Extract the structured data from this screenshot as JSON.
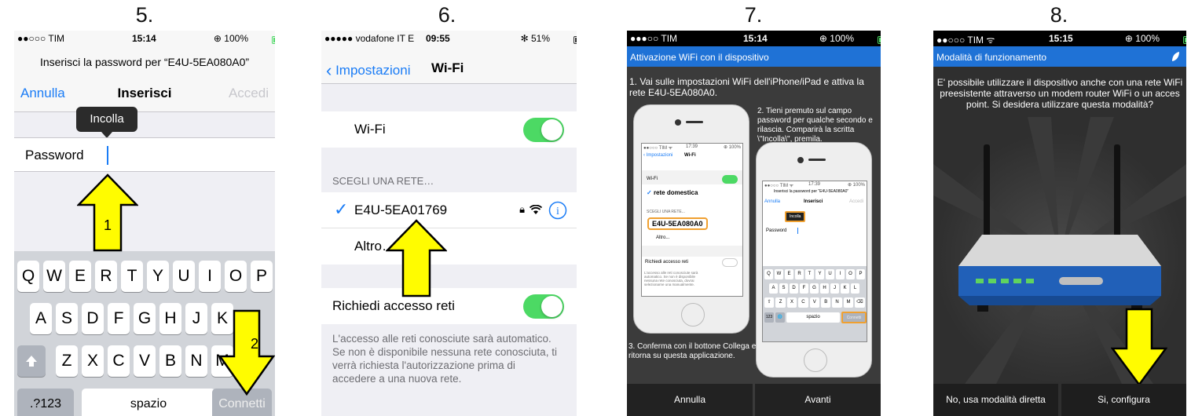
{
  "steps": [
    "5.",
    "6.",
    "7.",
    "8."
  ],
  "colors": {
    "ios_blue": "#1a7cf6",
    "toggle_green": "#4cd964",
    "app_blue": "#1f72d6",
    "arrow_yellow": "#fffc00",
    "highlight_orange": "#f0a030"
  },
  "p5": {
    "carrier": "●●○○○ TIM",
    "time": "15:14",
    "battery": "100%",
    "prompt": "Inserisci la password per “E4U-5EA080A0”",
    "cancel": "Annulla",
    "title": "Inserisci",
    "access": "Accedi",
    "paste": "Incolla",
    "password_label": "Password",
    "arrow1": "1",
    "arrow2": "2",
    "row1": [
      "Q",
      "W",
      "E",
      "R",
      "T",
      "Y",
      "U",
      "I",
      "O",
      "P"
    ],
    "row2": [
      "A",
      "S",
      "D",
      "F",
      "G",
      "H",
      "J",
      "K"
    ],
    "row3": [
      "Z",
      "X",
      "C",
      "V",
      "B",
      "N",
      "M"
    ],
    "numkey": ".?123",
    "space": "spazio",
    "connect": "Connetti"
  },
  "p6": {
    "carrier": "●●●●● vodafone IT  E",
    "time": "09:55",
    "battery": "51%",
    "back": "Impostazioni",
    "title": "Wi-Fi",
    "wifi_label": "Wi-Fi",
    "section": "SCEGLI UNA RETE…",
    "network": "E4U-5EA01769",
    "other": "Altro…",
    "ask_label": "Richiedi accesso reti",
    "footer": "L'accesso alle reti conosciute sarà automatico. Se non è disponibile nessuna rete conosciuta, ti verrà richiesta l'autorizzazione prima di accedere a una nuova rete."
  },
  "p7": {
    "carrier": "●●●○○ TIM",
    "time": "15:14",
    "battery": "100%",
    "bar_title": "Attivazione WiFi con il dispositivo",
    "text1": "1. Vai sulle impostazioni WiFi dell'iPhone/iPad e attiva la rete E4U-5EA080A0.",
    "text2": "2. Tieni premuto sul campo password per qualche secondo e rilascia. Comparirà la scritta \\\"Incolla\\\", premila.",
    "text3": "3. Conferma con il bottone Collega e ritorna su questa applicazione.",
    "btn_cancel": "Annulla",
    "btn_next": "Avanti",
    "mini_left": {
      "status_left": "●●○○○ TIM ᯤ",
      "status_time": "17:39",
      "status_right": "⊕ 100%",
      "back": "Impostazioni",
      "title": "Wi-Fi",
      "wifi": "Wi-Fi",
      "home_net": "rete domestica",
      "section": "SCEGLI UNA RETE...",
      "network": "E4U-5EA080A0",
      "other": "Altro...",
      "ask": "Richiedi accesso reti",
      "footer": "L'accesso alle reti conosciute sarà automatico. Se non è disponibile nessuna rete conosciuta, dovrai selezionarne una manualmente."
    },
    "mini_right": {
      "status_left": "●●○○○ TIM ᯤ",
      "status_time": "17:39",
      "status_right": "⊕ 100%",
      "prompt": "Inserisci la password per “E4U-5EA080A0”",
      "cancel": "Annulla",
      "title": "Inserisci",
      "access": "Accedi",
      "paste": "Incolla",
      "password": "Password",
      "row1": [
        "Q",
        "W",
        "E",
        "R",
        "T",
        "Y",
        "U",
        "I",
        "O",
        "P"
      ],
      "row2": [
        "A",
        "S",
        "D",
        "F",
        "G",
        "H",
        "J",
        "K",
        "L"
      ],
      "row3": [
        "⇧",
        "Z",
        "X",
        "C",
        "V",
        "B",
        "N",
        "M",
        "⌫"
      ],
      "numkey": "123",
      "globe": "🌐",
      "space": "spazio",
      "connect": "Connetti"
    }
  },
  "p8": {
    "carrier": "●●○○○ TIM ᯤ",
    "time": "15:15",
    "battery": "100%",
    "bar_title": "Modalità di funzionamento",
    "question": "E' possibile utilizzare il dispositivo anche con una rete WiFi preesistente attraverso un modem router WiFi o un acces point. Si desidera utilizzare questa modalità?",
    "btn_no": "No, usa modalità diretta",
    "btn_yes": "Si, configura"
  }
}
